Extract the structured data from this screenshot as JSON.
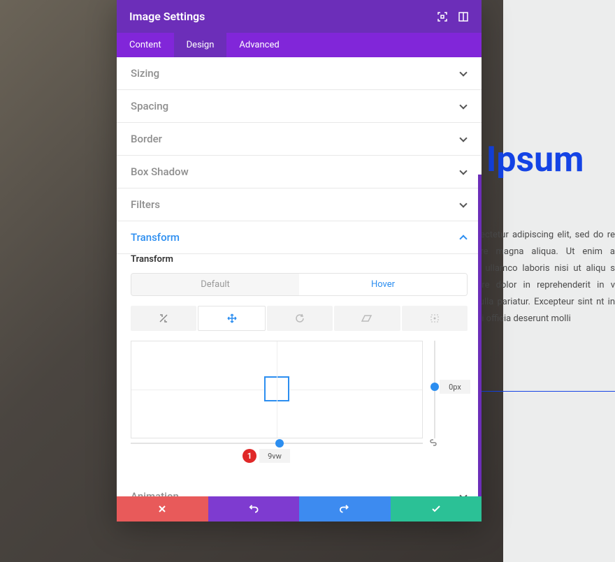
{
  "modal": {
    "title": "Image Settings",
    "tabs": [
      "Content",
      "Design",
      "Advanced"
    ],
    "active_tab": 1
  },
  "sections": {
    "sizing": "Sizing",
    "spacing": "Spacing",
    "border": "Border",
    "box_shadow": "Box Shadow",
    "filters": "Filters",
    "transform": "Transform",
    "animation": "Animation"
  },
  "transform": {
    "label": "Transform",
    "states": [
      "Default",
      "Hover"
    ],
    "active_state": 1,
    "x_value": "9vw",
    "y_value": "0px",
    "badge": "1"
  },
  "bg": {
    "heading": "m Ipsum",
    "body": "et, consectetur adipiscing elit, sed do re et dolore magna aliqua. Ut enim a rcitation ullamco laboris nisi ut aliqu s aute irure dolor in reprehenderit in v fugiat nulla pariatur. Excepteur sint nt in culpa qui officia deserunt molli"
  }
}
